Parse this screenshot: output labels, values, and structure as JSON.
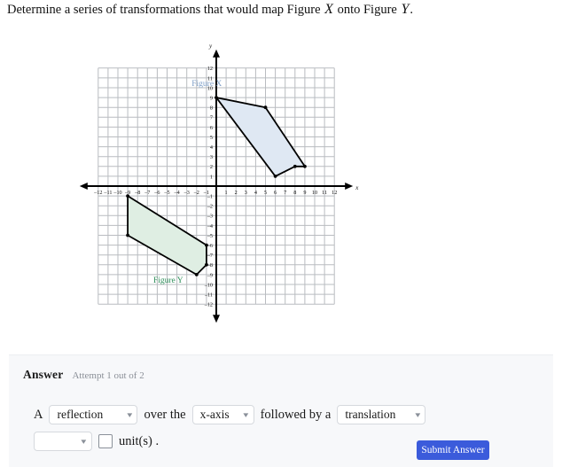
{
  "prompt": {
    "part1": "Determine a series of transformations that would map Figure",
    "var1": "X",
    "part2": "onto Figure",
    "var2": "Y",
    "part3": "."
  },
  "graph": {
    "x_axis_label": "x",
    "y_axis_label": "y",
    "x_range": [
      -12,
      12
    ],
    "y_range": [
      -12,
      12
    ],
    "x_ticks": [
      -12,
      -11,
      -10,
      -9,
      -8,
      -7,
      -6,
      -5,
      -4,
      -3,
      -2,
      -1,
      1,
      2,
      3,
      4,
      5,
      6,
      7,
      8,
      9,
      10,
      11,
      12
    ],
    "y_ticks": [
      12,
      11,
      10,
      9,
      8,
      7,
      6,
      5,
      4,
      3,
      2,
      1,
      -1,
      -2,
      -3,
      -4,
      -5,
      -6,
      -7,
      -8,
      -9,
      -10,
      -11,
      -12
    ],
    "grid_color": "#b9bcc0",
    "axis_color": "#000000",
    "figures": [
      {
        "label": "Figure X",
        "label_color": "#7d9fc8",
        "fill": "#dfe8f3",
        "stroke": "#000000",
        "label_pos": [
          -2.5,
          10.2
        ],
        "vertices": [
          [
            0,
            9
          ],
          [
            5,
            8
          ],
          [
            9,
            2
          ],
          [
            8,
            2
          ],
          [
            6,
            1
          ]
        ]
      },
      {
        "label": "Figure Y",
        "label_color": "#2f8f5b",
        "fill": "#dfeee3",
        "stroke": "#000000",
        "label_pos": [
          -6.4,
          -9.8
        ],
        "vertices": [
          [
            -9,
            -1
          ],
          [
            -9,
            -5
          ],
          [
            -2,
            -9
          ],
          [
            -1,
            -8
          ],
          [
            -1,
            -6
          ]
        ]
      }
    ]
  },
  "answer": {
    "title": "Answer",
    "attempt": "Attempt 1 out of 2",
    "line1": {
      "lit_a": "A",
      "reflection_value": "reflection",
      "lit_over_the": "over the",
      "axis_value": "x-axis",
      "lit_followed": "followed by a",
      "translation_value": "translation"
    },
    "line2": {
      "direction_value": "",
      "units_value": "",
      "lit_units": "unit(s) ."
    },
    "submit_label": "Submit Answer",
    "submit_color": "#3b5bdb"
  }
}
